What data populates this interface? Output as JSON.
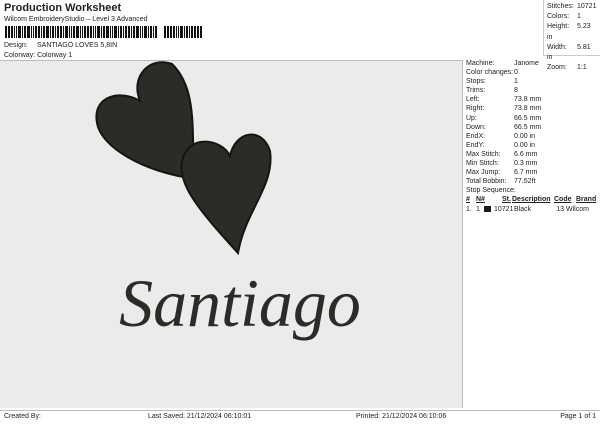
{
  "header": {
    "title": "Production Worksheet",
    "subtitle": "Wilcom EmbroideryStudio – Level 3 Advanced",
    "design_label": "Design:",
    "design": "SANTIAGO LOVES 5,8IN",
    "colorway_label": "Colorway:",
    "colorway": "Colorway 1"
  },
  "stats": [
    {
      "label": "Stitches:",
      "value": "10721"
    },
    {
      "label": "Colors:",
      "value": "1"
    },
    {
      "label": "Height:",
      "value": "5.23 in"
    },
    {
      "label": "Width:",
      "value": "5.81 in"
    },
    {
      "label": "Zoom:",
      "value": "1:1"
    }
  ],
  "info": [
    {
      "label": "Machine:",
      "value": "Janome"
    },
    {
      "label": "Color changes:",
      "value": "0"
    },
    {
      "label": "Stops:",
      "value": "1"
    },
    {
      "label": "Trims:",
      "value": "8"
    },
    {
      "label": "Left:",
      "value": "73.8 mm"
    },
    {
      "label": "Right:",
      "value": "73.8 mm"
    },
    {
      "label": "Up:",
      "value": "66.5 mm"
    },
    {
      "label": "Down:",
      "value": "66.5 mm"
    },
    {
      "label": "EndX:",
      "value": "0.00 in"
    },
    {
      "label": "EndY:",
      "value": "0.00 in"
    },
    {
      "label": "Max Stitch:",
      "value": "6.6 mm"
    },
    {
      "label": "Min Stitch:",
      "value": "0.3 mm"
    },
    {
      "label": "Max Jump:",
      "value": "6.7 mm"
    },
    {
      "label": "Total Bobbin:",
      "value": "77.52ft"
    }
  ],
  "stop_sequence": {
    "title": "Stop Sequence:",
    "headers": [
      "#",
      "N#",
      "St.",
      "Description",
      "Code",
      "Brand"
    ],
    "rows": [
      {
        "num": "1.",
        "n": "1",
        "color": "#1a1a1a",
        "st": "10721",
        "desc": "Black",
        "code": "13",
        "brand": "Wilcom"
      }
    ]
  },
  "design_text": "Santiago",
  "footer": {
    "created": "Created By:",
    "saved": "Last Saved: 21/12/2024 06:10:01",
    "printed": "Printed: 21/12/2024 06:10:06",
    "page": "Page 1 of 1"
  }
}
